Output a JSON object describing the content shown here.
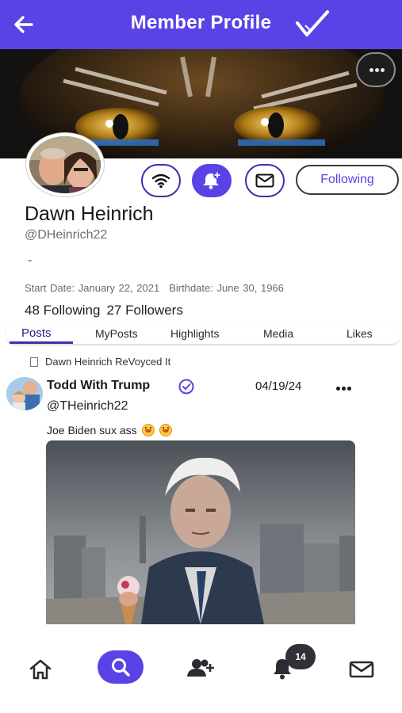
{
  "header": {
    "title": "Member Profile",
    "back_icon": "arrow-left-icon",
    "verified_icon": "checkmark-icon"
  },
  "banner": {
    "more_icon": "more-horizontal-icon"
  },
  "profile": {
    "name": "Dawn Heinrich",
    "handle": "@DHeinrich22",
    "bio": "-",
    "start_date": "Start Date: January 22, 2021",
    "birthdate": "Birthdate: June 30, 1966",
    "following": "48 Following",
    "followers": "27 Followers"
  },
  "actions": {
    "feed_icon": "wifi-icon",
    "notify_icon": "bell-plus-icon",
    "message_icon": "mail-icon",
    "follow_label": "Following"
  },
  "tabs": [
    {
      "label": "Posts",
      "active": true
    },
    {
      "label": "MyPosts",
      "active": false
    },
    {
      "label": "Highlights",
      "active": false
    },
    {
      "label": "Media",
      "active": false
    },
    {
      "label": "Likes",
      "active": false
    }
  ],
  "post": {
    "revoyced_text": "Dawn Heinrich ReVoyced It",
    "author": "Todd With Trump",
    "date": "04/19/24",
    "handle": "@THeinrich22",
    "text": "Joe Biden sux ass"
  },
  "bottom_nav": {
    "items": [
      "home-icon",
      "search-icon",
      "add-friend-icon",
      "bell-icon",
      "mail-icon"
    ],
    "notification_count": "14"
  },
  "colors": {
    "brand": "#5a43e6",
    "dark_badge": "#303039"
  }
}
